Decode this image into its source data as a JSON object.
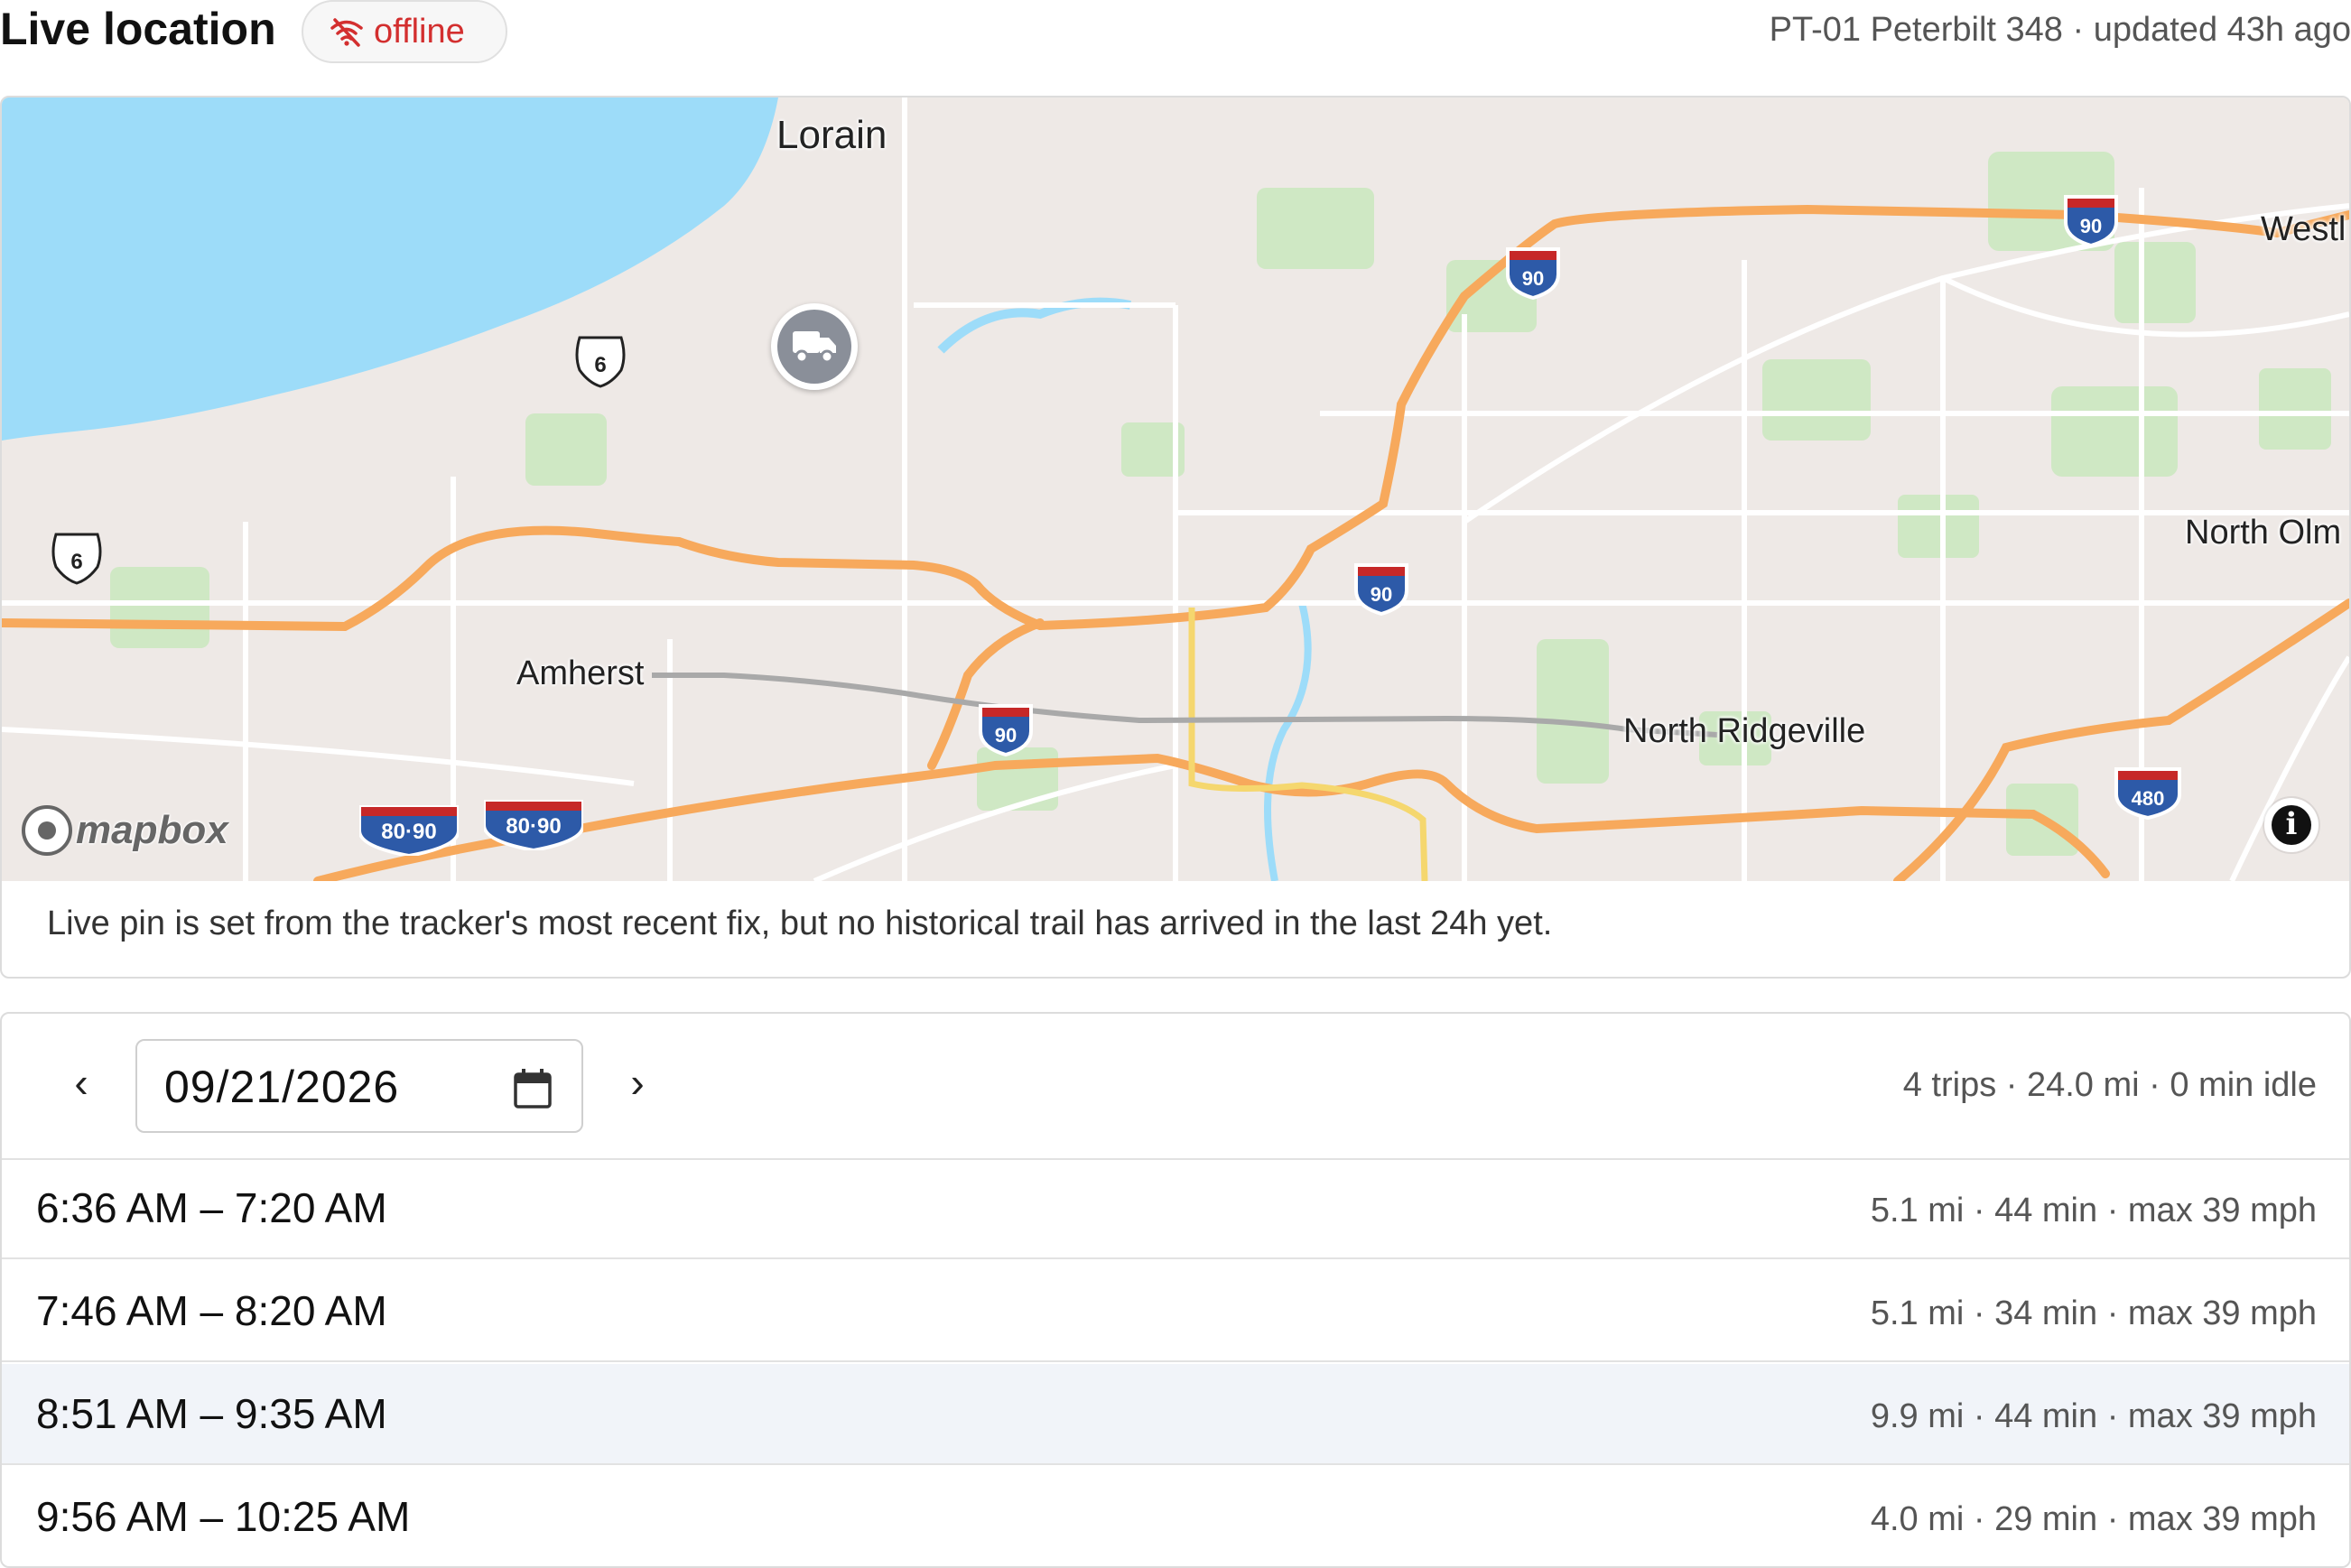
{
  "header": {
    "title": "Live location",
    "status_badge": "offline",
    "status_icon": "wifi-off-icon",
    "status_color": "#d32f2f",
    "vehicle_info": "PT-01 Peterbilt 348 · updated 43h ago"
  },
  "map": {
    "places": {
      "lorain": "Lorain",
      "amherst": "Amherst",
      "north_ridgeville": "North Ridgeville",
      "westlake": "Westl",
      "north_olmsted": "North Olm"
    },
    "highway_shields": {
      "i90": "90",
      "i480": "480",
      "i80_90": "80·90",
      "us6": "6"
    },
    "attribution": "mapbox",
    "vehicle_marker_icon": "truck-icon",
    "note": "Live pin is set from the tracker's most recent fix, but no historical trail has arrived in the last 24h yet.",
    "colors": {
      "land": "#eee9e6",
      "water": "#9ddcf9",
      "park": "#cfe8c4",
      "highway": "#f7a95c",
      "road": "#ffffff",
      "trail": "#a9a9a9"
    }
  },
  "trips": {
    "prev_label": "‹",
    "next_label": "›",
    "date": "09/21/2026",
    "summary": "4 trips · 24.0 mi · 0 min idle",
    "items": [
      {
        "time": "6:36 AM – 7:20 AM",
        "stats": "5.1 mi · 44 min · max 39 mph"
      },
      {
        "time": "7:46 AM – 8:20 AM",
        "stats": "5.1 mi · 34 min · max 39 mph"
      },
      {
        "time": "8:51 AM – 9:35 AM",
        "stats": "9.9 mi · 44 min · max 39 mph"
      },
      {
        "time": "9:56 AM – 10:25 AM",
        "stats": "4.0 mi · 29 min · max 39 mph"
      }
    ],
    "selected_index": 2
  }
}
